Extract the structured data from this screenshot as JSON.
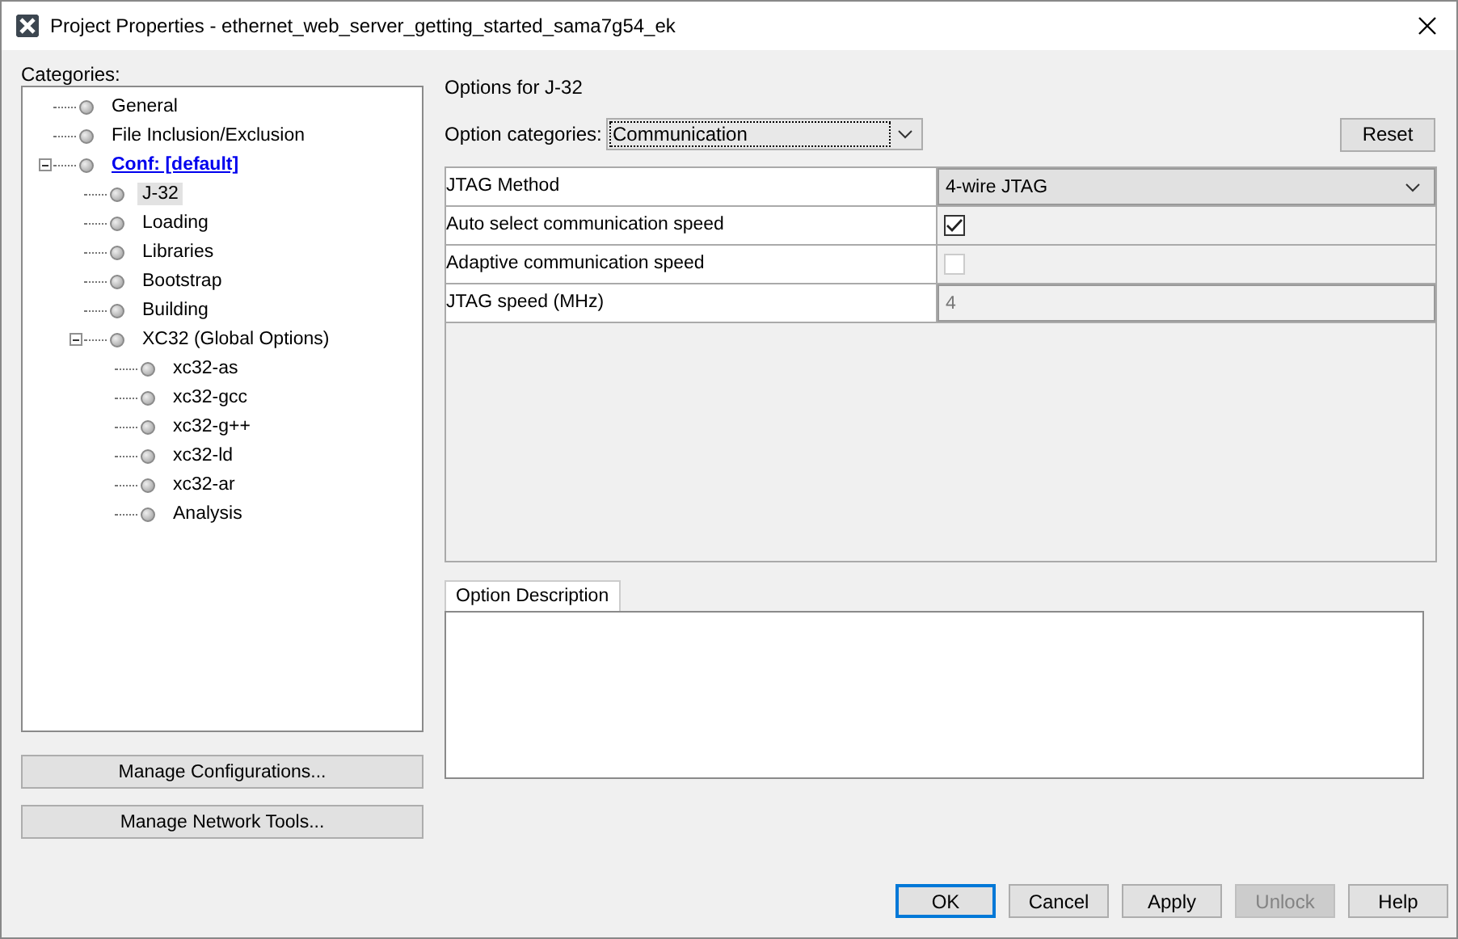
{
  "window": {
    "title": "Project Properties - ethernet_web_server_getting_started_sama7g54_ek"
  },
  "categories": {
    "label": "Categories:",
    "items": [
      {
        "label": "General",
        "selected": false
      },
      {
        "label": "File Inclusion/Exclusion",
        "selected": false
      },
      {
        "label": "Conf: [default]",
        "selected": false,
        "kind": "link",
        "expanded": true,
        "children": [
          {
            "label": "J-32",
            "selected": true
          },
          {
            "label": "Loading",
            "selected": false
          },
          {
            "label": "Libraries",
            "selected": false
          },
          {
            "label": "Bootstrap",
            "selected": false
          },
          {
            "label": "Building",
            "selected": false
          },
          {
            "label": "XC32 (Global Options)",
            "selected": false,
            "expanded": true,
            "children": [
              {
                "label": "xc32-as",
                "selected": false
              },
              {
                "label": "xc32-gcc",
                "selected": false
              },
              {
                "label": "xc32-g++",
                "selected": false
              },
              {
                "label": "xc32-ld",
                "selected": false
              },
              {
                "label": "xc32-ar",
                "selected": false
              },
              {
                "label": "Analysis",
                "selected": false
              }
            ]
          }
        ]
      }
    ]
  },
  "left_buttons": [
    "Manage Configurations...",
    "Manage Network Tools..."
  ],
  "options": {
    "title": "Options for J-32",
    "category_label": "Option categories:",
    "category_value": "Communication",
    "reset": "Reset",
    "properties": [
      {
        "name": "JTAG Method",
        "kind": "dropdown",
        "value": "4-wire JTAG"
      },
      {
        "name": "Auto select communication speed",
        "kind": "checkbox",
        "checked": true,
        "disabled": false
      },
      {
        "name": "Adaptive communication speed",
        "kind": "checkbox",
        "checked": false,
        "disabled": true
      },
      {
        "name": "JTAG speed (MHz)",
        "kind": "text",
        "value": "4",
        "disabled": true
      }
    ]
  },
  "description_tab": "Option Description",
  "buttons": [
    {
      "label": "OK",
      "default": true,
      "disabled": false
    },
    {
      "label": "Cancel",
      "default": false,
      "disabled": false
    },
    {
      "label": "Apply",
      "default": false,
      "disabled": false
    },
    {
      "label": "Unlock",
      "default": false,
      "disabled": true
    },
    {
      "label": "Help",
      "default": false,
      "disabled": false
    }
  ]
}
